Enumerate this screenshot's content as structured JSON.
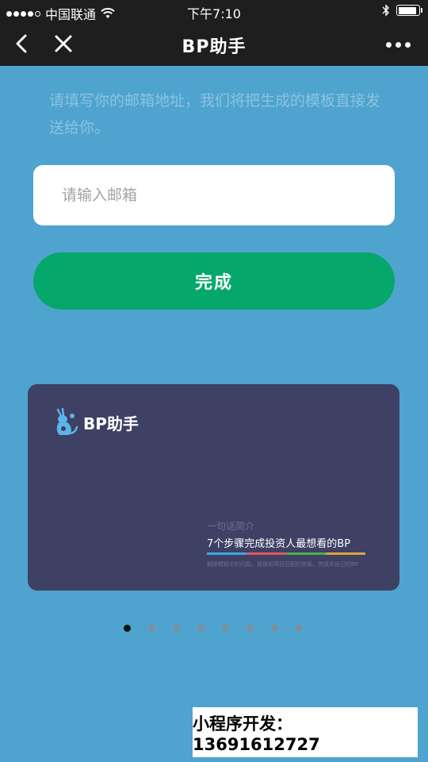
{
  "status_bar": {
    "carrier": "中国联通",
    "time": "下午7:10",
    "battery_level": 0.9
  },
  "nav": {
    "title": "BP助手",
    "back_icon": "chevron-left-icon",
    "close_icon": "close-icon",
    "more_icon": "more-dots-icon"
  },
  "form": {
    "intro": "请填写你的邮箱地址，我们将把生成的模板直接发送给你。",
    "email_placeholder": "请输入邮箱",
    "email_value": "",
    "submit_label": "完成"
  },
  "template_card": {
    "brand": "BP助手",
    "subtitle": "一句话简介",
    "tagline": "7个步骤完成投资人最想看的BP",
    "fine_print": "解除模板中的问题，替换和项目匹配的答案，完成你自己的BP",
    "line_colors": [
      "#3aa7e0",
      "#e05a5a",
      "#4caf50",
      "#e0a33a"
    ]
  },
  "carousel": {
    "count": 8,
    "active_index": 0
  },
  "watermark": {
    "text": "小程序开发：13691612727"
  },
  "colors": {
    "background": "#4fa3cf",
    "bar": "#1e1e1e",
    "accent_green": "#05a86a",
    "card": "#3e4064"
  }
}
